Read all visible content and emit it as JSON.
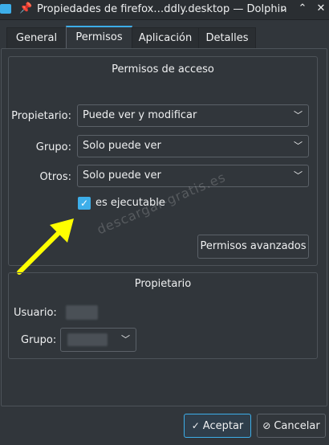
{
  "window": {
    "title": "Propiedades de firefox…ddly.desktop — Dolphin"
  },
  "tabs": [
    {
      "label": "General"
    },
    {
      "label": "Permisos"
    },
    {
      "label": "Aplicación"
    },
    {
      "label": "Detalles"
    }
  ],
  "access": {
    "title": "Permisos de acceso",
    "owner_label": "Propietario:",
    "owner_value": "Puede ver y modificar",
    "group_label": "Grupo:",
    "group_value": "Solo puede ver",
    "others_label": "Otros:",
    "others_value": "Solo puede ver",
    "exec_label": "es ejecutable",
    "exec_checked": true,
    "advanced_button": "Permisos avanzados"
  },
  "ownership": {
    "title": "Propietario",
    "user_label": "Usuario:",
    "group_label": "Grupo:"
  },
  "footer": {
    "accept": "Aceptar",
    "cancel": "Cancelar"
  },
  "watermark": "descargar-gratis.es",
  "colors": {
    "accent": "#3daee9",
    "background": "#31363b",
    "annotation_arrow": "#ffff00"
  }
}
